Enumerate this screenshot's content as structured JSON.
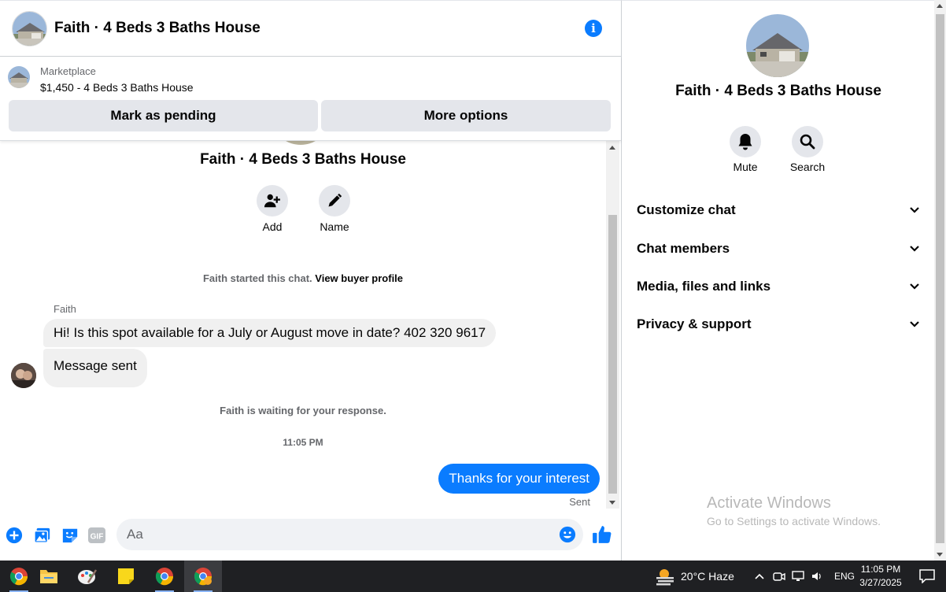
{
  "header": {
    "title": "Faith · 4 Beds 3 Baths House",
    "info_icon": "info-icon"
  },
  "listing": {
    "source": "Marketplace",
    "item": "$1,450 - 4 Beds 3 Baths House",
    "mark_pending": "Mark as pending",
    "more_options": "More options"
  },
  "thread": {
    "title": "Faith · 4 Beds 3 Baths House",
    "add_label": "Add",
    "name_label": "Name",
    "started_text": "Faith started this chat.",
    "view_profile": "View buyer profile",
    "sender": "Faith",
    "messages_in": [
      "Hi! Is this spot available for a July or August move in date? 402 320 9617",
      "Message sent"
    ],
    "waiting_text": "Faith is waiting for your response.",
    "timestamp": "11:05 PM",
    "message_out": "Thanks for your interest",
    "status": "Sent"
  },
  "composer": {
    "placeholder": "Aa",
    "accent": "#0a7cff"
  },
  "panel": {
    "title": "Faith · 4 Beds 3 Baths House",
    "mute": "Mute",
    "search": "Search",
    "sections": [
      "Customize chat",
      "Chat members",
      "Media, files and links",
      "Privacy & support"
    ]
  },
  "watermark": {
    "line1": "Activate Windows",
    "line2": "Go to Settings to activate Windows."
  },
  "taskbar": {
    "weather": "20°C  Haze",
    "lang": "ENG",
    "time": "11:05 PM",
    "date": "3/27/2025"
  }
}
